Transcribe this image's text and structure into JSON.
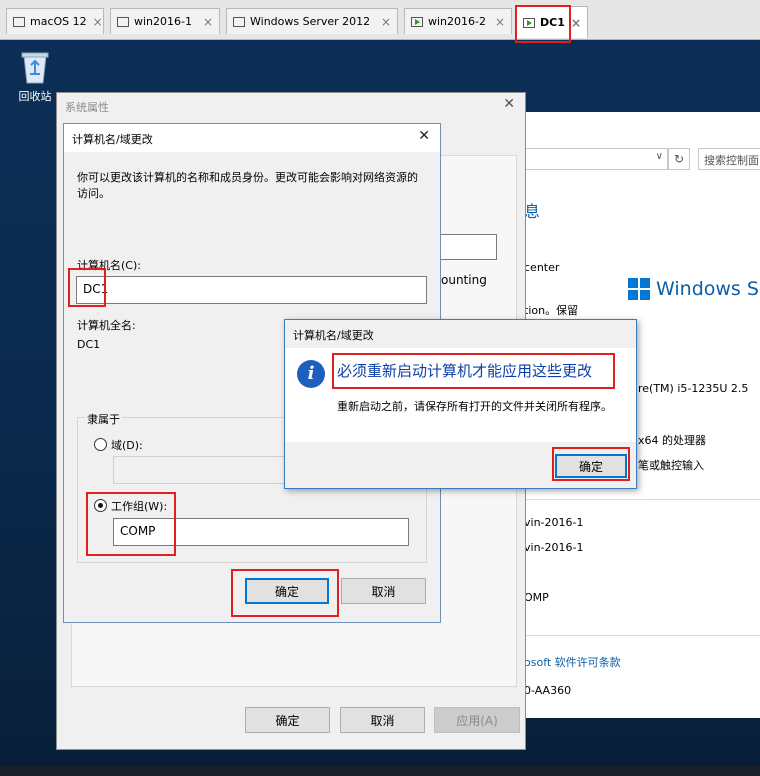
{
  "tabs": [
    {
      "label": "macOS 12",
      "active": false,
      "icon": "vm-icon"
    },
    {
      "label": "win2016-1",
      "active": false,
      "icon": "vm-icon"
    },
    {
      "label": "Windows Server 2012",
      "active": false,
      "icon": "vm-icon"
    },
    {
      "label": "win2016-2",
      "active": false,
      "icon": "vm-running-icon"
    },
    {
      "label": "DC1",
      "active": true,
      "icon": "vm-running-icon"
    }
  ],
  "tab_close_glyph": "×",
  "desktop": {
    "recycle_bin_label": "回收站"
  },
  "control_panel": {
    "search_placeholder": "搜索控制面",
    "heading": "息",
    "lines": [
      "center",
      "tion。保留",
      "re(TM) i5-1235U   2.5",
      "x64 的处理器",
      "笔或触控输入",
      "vin-2016-1",
      "vin-2016-1",
      "OMP",
      "osoft 软件许可条款",
      "0-AA360"
    ],
    "windows_logo_text": "Windows Ser",
    "accent_color": "#0b5ea8"
  },
  "system_properties": {
    "title": "系统属性",
    "partial_text": "ounting",
    "buttons": {
      "ok": "确定",
      "cancel": "取消",
      "apply": "应用(A)"
    }
  },
  "computer_name_dialog": {
    "title": "计算机名/域更改",
    "description": "你可以更改该计算机的名称和成员身份。更改可能会影响对网络资源的访问。",
    "computer_name_label": "计算机名(C):",
    "computer_name_value": "DC1",
    "full_name_label": "计算机全名:",
    "full_name_value": "DC1",
    "member_of_label": "隶属于",
    "domain_label": "域(D):",
    "domain_value": "",
    "domain_checked": false,
    "workgroup_label": "工作组(W):",
    "workgroup_value": "COMP",
    "workgroup_checked": true,
    "ok_label": "确定",
    "cancel_label": "取消"
  },
  "message_box": {
    "title": "计算机名/域更改",
    "icon": "info-icon",
    "main_instruction": "必须重新启动计算机才能应用这些更改",
    "content": "重新启动之前，请保存所有打开的文件并关闭所有程序。",
    "ok_label": "确定",
    "instruction_color": "#0d3fa8"
  },
  "annotation_color": "#e02020"
}
